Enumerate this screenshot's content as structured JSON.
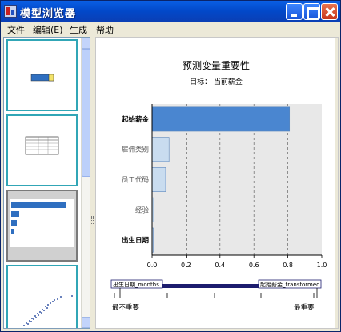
{
  "window": {
    "title": "模型浏览器"
  },
  "menu": [
    {
      "label": "文件"
    },
    {
      "label": "编辑(E)"
    },
    {
      "label": "生成"
    },
    {
      "label": "帮助"
    }
  ],
  "chart": {
    "title": "预测变量重要性",
    "subtitle": "目标： 当前薪金"
  },
  "chart_data": {
    "type": "bar",
    "orientation": "horizontal",
    "title": "预测变量重要性",
    "subtitle": "目标： 当前薪金",
    "categories": [
      "起始薪金",
      "雇佣类别",
      "员工代码",
      "经验",
      "出生日期"
    ],
    "values": [
      0.81,
      0.1,
      0.08,
      0.01,
      0.005
    ],
    "xlim": [
      0.0,
      1.0
    ],
    "xticks": [
      "0.0",
      "0.2",
      "0.4",
      "0.6",
      "0.8",
      "1.0"
    ],
    "grid": "vertical dashed",
    "bar_color": "#4a86d0",
    "highlight_color": "#c9dcef"
  },
  "legend": {
    "left_tag": "出生日期_months",
    "right_tag": "起始薪金_transformed",
    "left_label": "最不重要",
    "right_label": "最重要"
  },
  "colors": {
    "accent": "#0a5fe4",
    "thumb_border": "#31a6b6",
    "bar": "#4a86d0"
  }
}
